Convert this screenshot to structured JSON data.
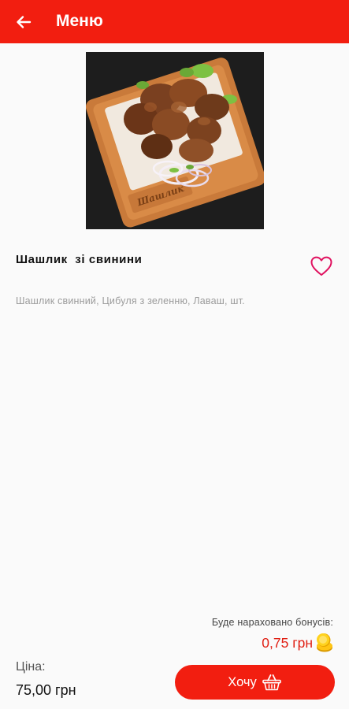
{
  "header": {
    "title": "Меню",
    "back_icon": "arrow-left-icon",
    "background_color": "#f21e10"
  },
  "product": {
    "image": "grilled pork skewer meat on wooden board with onion",
    "name": "Шашлик  зі свинини",
    "description": "Шашлик свинний, Цибуля з зеленню, Лаваш, шт.",
    "favorite_icon": "heart-outline-icon",
    "board_engraving": "Шашлик"
  },
  "bonus": {
    "label": "Буде нараховано бонусів:",
    "value": "0,75 грн",
    "icon": "coin-icon",
    "value_color": "#e01e12"
  },
  "price": {
    "label": "Ціна:",
    "value": "75,00 грн"
  },
  "action": {
    "button_label": "Хочу",
    "icon": "basket-icon"
  }
}
